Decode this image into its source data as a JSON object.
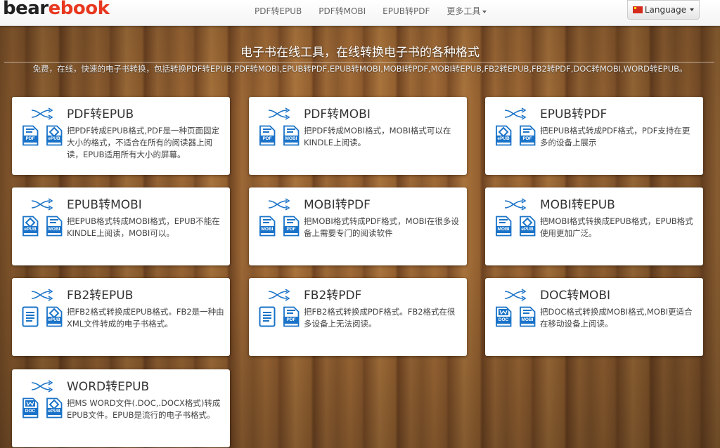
{
  "brand": {
    "part1": "bear",
    "part2": "ebook"
  },
  "nav": {
    "items": [
      "PDF转EPUB",
      "PDF转MOBI",
      "EPUB转PDF",
      "更多工具"
    ],
    "language_label": "Language"
  },
  "hero": {
    "title": "电子书在线工具，在线转换电子书的各种格式",
    "subtitle": "免费，在线，快速的电子书转换，包括转换PDF转EPUB,PDF转MOBI,EPUB转PDF,EPUB转MOBI,MOBI转PDF,MOBI转EPUB,FB2转EPUB,FB2转PDF,DOC转MOBI,WORD转EPUB。"
  },
  "colors": {
    "accent": "#1a73c8",
    "brand_red": "#e8381f"
  },
  "cards": [
    {
      "title": "PDF转EPUB",
      "desc": "把PDF转成EPUB格式,PDF是一种页面固定大小的格式，不适合在所有的阅读器上阅读，EPUB适用所有大小的屏幕。",
      "from": "PDF",
      "to": "ePUB",
      "from_icon": "pdf-file-icon",
      "to_icon": "epub-file-icon"
    },
    {
      "title": "PDF转MOBI",
      "desc": "把PDF转成MOBI格式，MOBI格式可以在KINDLE上阅读。",
      "from": "PDF",
      "to": "MOBI",
      "from_icon": "pdf-file-icon",
      "to_icon": "mobi-file-icon"
    },
    {
      "title": "EPUB转PDF",
      "desc": "把EPUB格式转成PDF格式，PDF支持在更多的设备上展示",
      "from": "ePUB",
      "to": "PDF",
      "from_icon": "epub-file-icon",
      "to_icon": "pdf-file-icon"
    },
    {
      "title": "EPUB转MOBI",
      "desc": "把EPUB格式转成MOBI格式，EPUB不能在KINDLE上阅读，MOBI可以。",
      "from": "ePUB",
      "to": "MOBI",
      "from_icon": "epub-file-icon",
      "to_icon": "mobi-file-icon"
    },
    {
      "title": "MOBI转PDF",
      "desc": "把MOBI格式转成PDF格式，MOBI在很多设备上需要专门的阅读软件",
      "from": "MOBI",
      "to": "PDF",
      "from_icon": "mobi-file-icon",
      "to_icon": "pdf-file-icon"
    },
    {
      "title": "MOBI转EPUB",
      "desc": "把MOBI格式转换成EPUB格式，EPUB格式使用更加广泛。",
      "from": "MOBI",
      "to": "ePUB",
      "from_icon": "mobi-file-icon",
      "to_icon": "epub-file-icon"
    },
    {
      "title": "FB2转EPUB",
      "desc": "把FB2格式转换成EPUB格式。FB2是一种由XML文件转成的电子书格式。",
      "from": "",
      "to": "ePUB",
      "from_icon": "fb2-file-icon",
      "to_icon": "epub-file-icon"
    },
    {
      "title": "FB2转PDF",
      "desc": "把FB2格式转换成PDF格式。FB2格式在很多设备上无法阅读。",
      "from": "",
      "to": "PDF",
      "from_icon": "fb2-file-icon",
      "to_icon": "pdf-file-icon"
    },
    {
      "title": "DOC转MOBI",
      "desc": "把DOC格式转换成MOBI格式,MOBI更适合在移动设备上阅读。",
      "from": "DOC",
      "to": "MOBI",
      "from_icon": "doc-file-icon",
      "to_icon": "mobi-file-icon"
    },
    {
      "title": "WORD转EPUB",
      "desc": "把MS WORD文件(.DOC,.DOCX格式)转成EPUB文件。EPUB是流行的电子书格式。",
      "from": "DOC",
      "to": "ePUB",
      "from_icon": "doc-file-icon",
      "to_icon": "epub-file-icon"
    }
  ]
}
